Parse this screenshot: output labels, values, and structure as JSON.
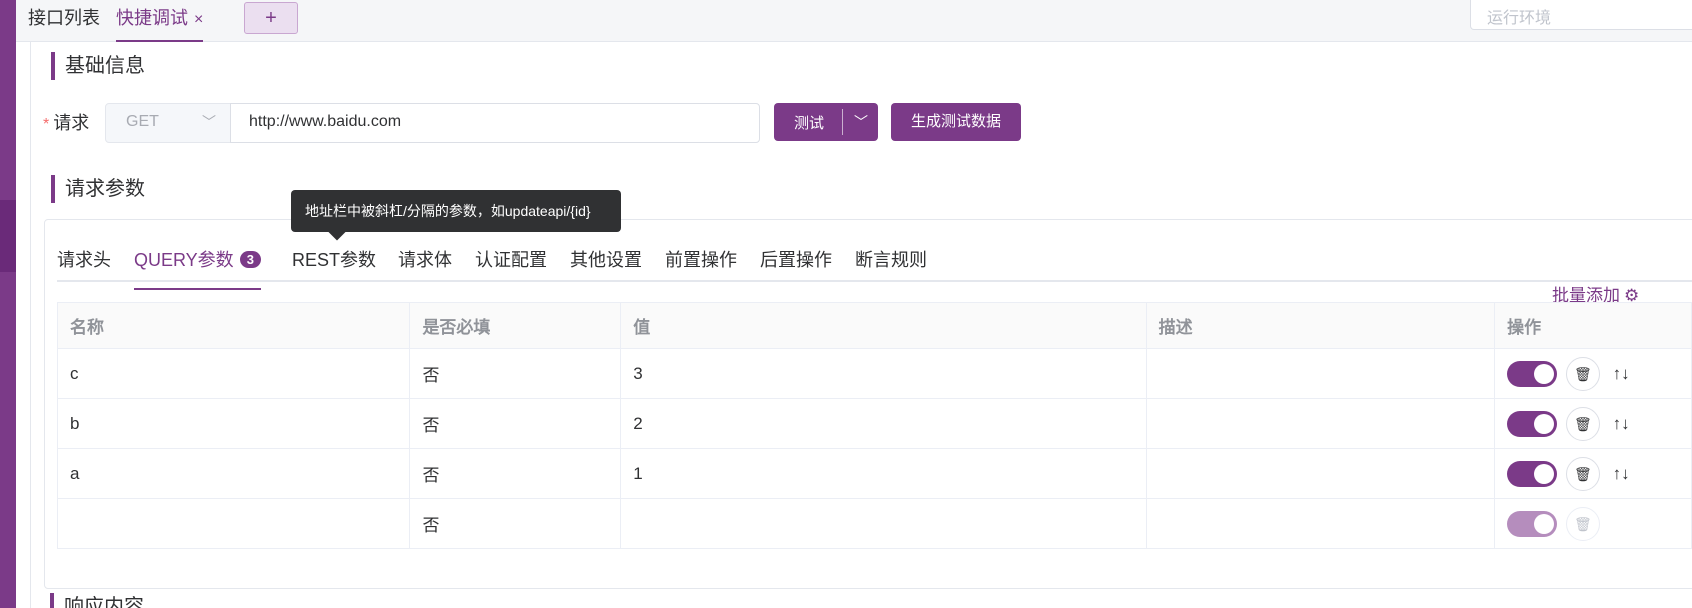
{
  "topbar": {
    "tabs": [
      {
        "label": "接口列表"
      },
      {
        "label": "快捷调试"
      }
    ],
    "add_label": "+",
    "close_glyph": "×",
    "env_placeholder": "运行环境"
  },
  "basic": {
    "title": "基础信息",
    "request_label": "请求",
    "required_mark": "*",
    "method": "GET",
    "url": "http://www.baidu.com",
    "test_button": "测试",
    "gen_button": "生成测试数据"
  },
  "params": {
    "title": "请求参数",
    "tooltip": "地址栏中被斜杠/分隔的参数，如updateapi/{id}",
    "tabs": [
      {
        "label": "请求头"
      },
      {
        "label": "QUERY参数",
        "badge": "3"
      },
      {
        "label": "REST参数"
      },
      {
        "label": "请求体"
      },
      {
        "label": "认证配置"
      },
      {
        "label": "其他设置"
      },
      {
        "label": "前置操作"
      },
      {
        "label": "后置操作"
      },
      {
        "label": "断言规则"
      }
    ],
    "batch_add": "批量添加",
    "columns": [
      "名称",
      "是否必填",
      "值",
      "描述",
      "操作"
    ],
    "rows": [
      {
        "name": "c",
        "required": "否",
        "value": "3",
        "desc": "",
        "enabled": true
      },
      {
        "name": "b",
        "required": "否",
        "value": "2",
        "desc": "",
        "enabled": true
      },
      {
        "name": "a",
        "required": "否",
        "value": "1",
        "desc": "",
        "enabled": true
      },
      {
        "name": "",
        "required": "否",
        "value": "",
        "desc": "",
        "enabled": true
      }
    ],
    "move_arrows": "↑↓"
  },
  "response": {
    "title": "响应内容"
  },
  "colors": {
    "accent": "#7b3a88",
    "sidebar": "#7b3a88"
  }
}
